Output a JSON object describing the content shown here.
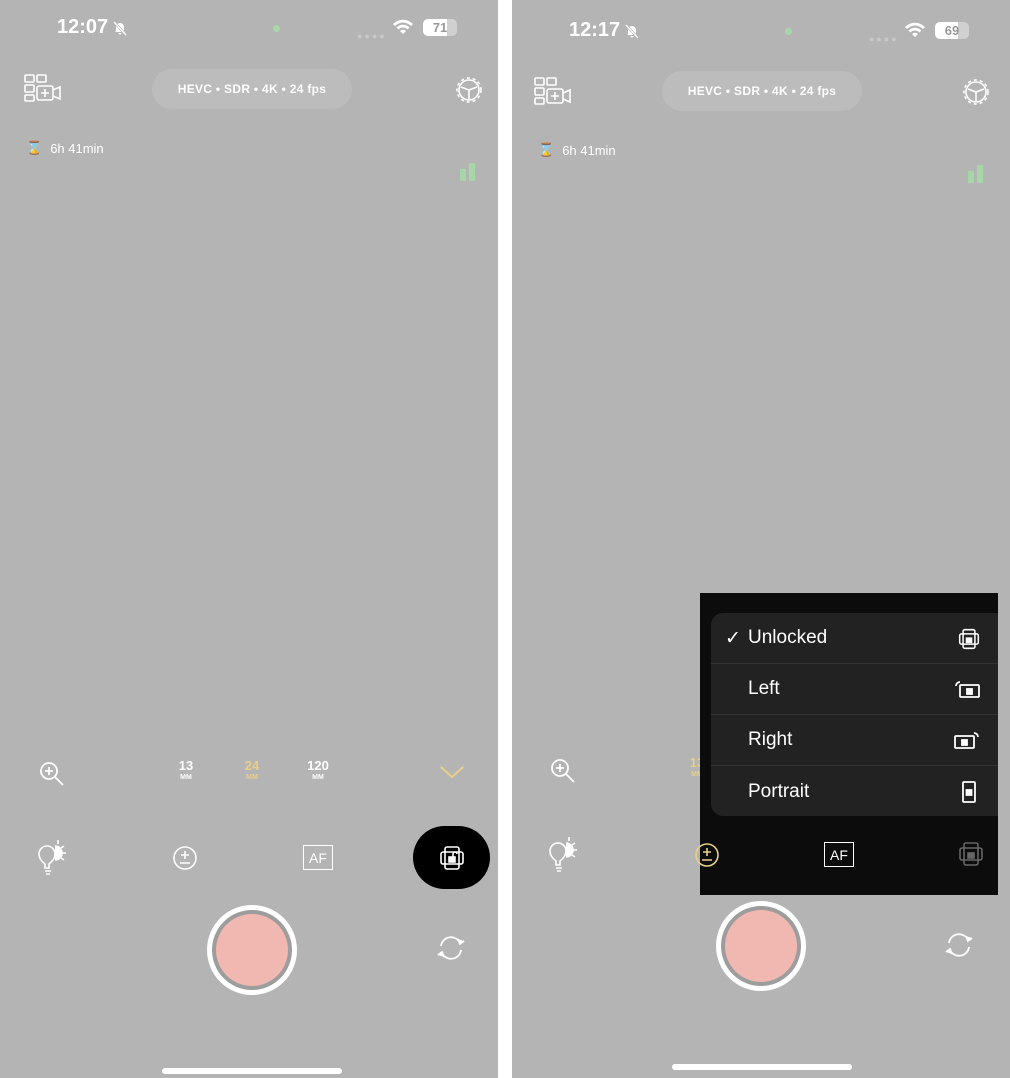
{
  "panels": [
    {
      "status": {
        "time": "12:07",
        "battery": "71",
        "battery_level": 71
      },
      "format_label": "HEVC • SDR • 4K • 24 fps",
      "remaining": "6h 41min",
      "lenses": [
        {
          "value": "13",
          "unit": "MM"
        },
        {
          "value": "24",
          "unit": "MM",
          "selected": true
        },
        {
          "value": "120",
          "unit": "MM"
        }
      ],
      "af_label": "AF",
      "orientation_button_active": true
    },
    {
      "status": {
        "time": "12:17",
        "battery": "69",
        "battery_level": 69
      },
      "format_label": "HEVC • SDR • 4K • 24 fps",
      "remaining": "6h 41min",
      "lenses": [
        {
          "value": "13",
          "unit": "MM",
          "selected": true
        }
      ],
      "af_label": "AF",
      "orientation_menu": {
        "items": [
          {
            "label": "Unlocked",
            "checked": true,
            "icon": "rotation-unlocked-icon"
          },
          {
            "label": "Left",
            "checked": false,
            "icon": "rotate-left-icon"
          },
          {
            "label": "Right",
            "checked": false,
            "icon": "rotate-right-icon"
          },
          {
            "label": "Portrait",
            "checked": false,
            "icon": "portrait-lock-icon"
          }
        ]
      }
    }
  ],
  "colors": {
    "accent": "#e8cf8a",
    "record": "#f1b8b1",
    "background": "#b4b4b4",
    "green": "#a7d7a8"
  },
  "checkmark": "✓"
}
